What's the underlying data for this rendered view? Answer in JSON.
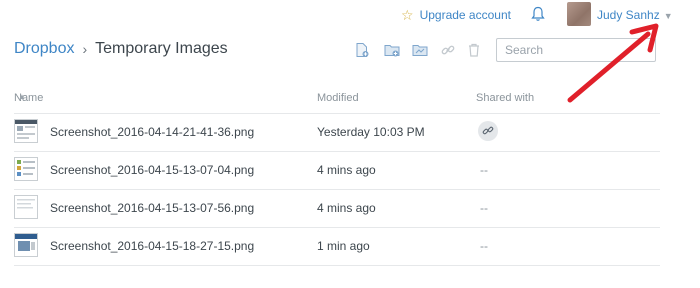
{
  "header": {
    "upgrade_label": "Upgrade account",
    "user_name": "Judy Sanhz",
    "icons": [
      "star-icon",
      "bell-icon",
      "avatar",
      "chevron-down-icon"
    ]
  },
  "breadcrumb": {
    "root": "Dropbox",
    "separator": "›",
    "current": "Temporary Images"
  },
  "toolbar": {
    "icons": [
      "new-file-icon",
      "new-folder-icon",
      "shared-folder-icon",
      "link-icon",
      "trash-icon"
    ]
  },
  "search": {
    "placeholder": "Search"
  },
  "table": {
    "columns": {
      "name": "Name",
      "modified": "Modified",
      "shared": "Shared with"
    },
    "rows": [
      {
        "name": "Screenshot_2016-04-14-21-41-36.png",
        "modified": "Yesterday 10:03 PM",
        "shared": ""
      },
      {
        "name": "Screenshot_2016-04-15-13-07-04.png",
        "modified": "4 mins ago",
        "shared": "--"
      },
      {
        "name": "Screenshot_2016-04-15-13-07-56.png",
        "modified": "4 mins ago",
        "shared": "--"
      },
      {
        "name": "Screenshot_2016-04-15-18-27-15.png",
        "modified": "1 min ago",
        "shared": "--"
      }
    ]
  },
  "colors": {
    "link_blue": "#3f86c6",
    "annotation_red": "#e0202a",
    "star_gold": "#d6b44a"
  }
}
